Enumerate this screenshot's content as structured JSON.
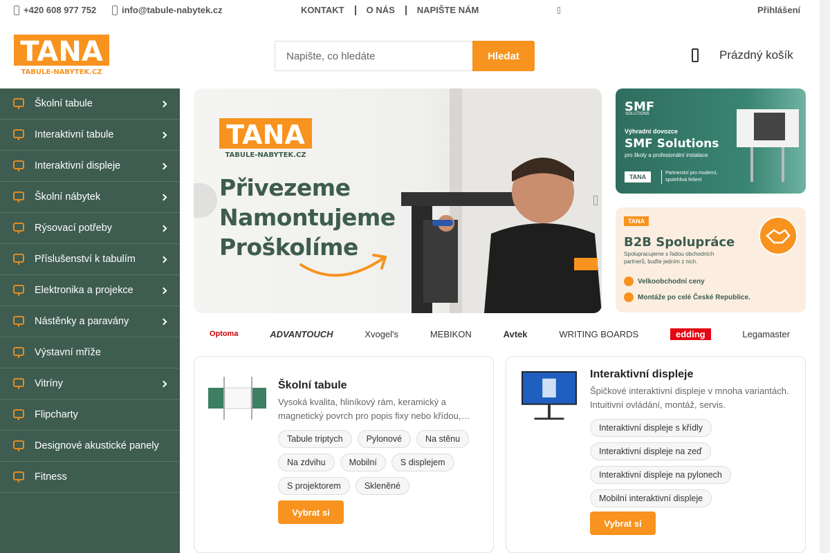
{
  "topbar": {
    "phone": "+420 608 977 752",
    "email": "info@tabule-nabytek.cz",
    "nav": [
      "KONTAKT",
      "O NÁS",
      "NAPIŠTE NÁM"
    ],
    "login": "Přihlášení"
  },
  "header": {
    "logo_text": "TANA",
    "logo_sub": "TABULE-NABYTEK.CZ",
    "search_placeholder": "Napište, co hledáte",
    "search_button": "Hledat",
    "cart_label": "Prázdný košík"
  },
  "sidebar": {
    "items": [
      {
        "label": "Školní tabule",
        "icon": "board-icon",
        "arrow": true
      },
      {
        "label": "Interaktivní tabule",
        "icon": "interactive-board-icon",
        "arrow": true
      },
      {
        "label": "Interaktivní displeje",
        "icon": "display-icon",
        "arrow": true
      },
      {
        "label": "Školní nábytek",
        "icon": "chair-icon",
        "arrow": true
      },
      {
        "label": "Rýsovací potřeby",
        "icon": "ruler-icon",
        "arrow": true
      },
      {
        "label": "Příslušenství k tabulím",
        "icon": "pencil-icon",
        "arrow": true
      },
      {
        "label": "Elektronika a projekce",
        "icon": "projector-icon",
        "arrow": true
      },
      {
        "label": "Nástěnky a paravány",
        "icon": "pin-icon",
        "arrow": true
      },
      {
        "label": "Výstavní mříže",
        "icon": "grid-icon",
        "arrow": false
      },
      {
        "label": "Vitríny",
        "icon": "cabinet-icon",
        "arrow": true
      },
      {
        "label": "Flipcharty",
        "icon": "flipchart-icon",
        "arrow": false
      },
      {
        "label": "Designové akustické panely",
        "icon": "sound-icon",
        "arrow": false
      },
      {
        "label": "Fitness",
        "icon": "dumbbell-icon",
        "arrow": false
      }
    ]
  },
  "banner": {
    "logo_text": "TANA",
    "logo_sub": "TABULE-NABYTEK.CZ",
    "lines": [
      "Přivezeme",
      "Namontujeme",
      "Proškolíme"
    ]
  },
  "promo1": {
    "brand": "SMF",
    "brand_sub": "SOLUTIONS",
    "kicker": "Výhradní dovozce",
    "title": "SMF Solutions",
    "subtitle": "pro školy a profesionální instalace",
    "logo_text": "TANA",
    "partner": "Partnerství pro moderní, spolehlivá řešení"
  },
  "promo2": {
    "logo_text": "TANA",
    "title": "B2B Spolupráce",
    "text": "Spolupracujeme s řadou obchodních partnerů, buďte jedním z nich.",
    "bullets": [
      "Velkoobchodní ceny",
      "Montáže po celé České Republice."
    ]
  },
  "brands": [
    "Optoma",
    "ADVANTOUCH",
    "Xvogel's",
    "MEBIKON",
    "Avtek",
    "WRITING BOARDS",
    "edding",
    "Legamaster"
  ],
  "cards": [
    {
      "title": "Školní tabule",
      "desc": "Vysoká kvalita, hliníkový rám, keramický a magnetický povrch pro popis fixy nebo křídou,…",
      "tags": [
        "Tabule triptych",
        "Pylonové",
        "Na stěnu",
        "Na zdvihu",
        "Mobilní",
        "S displejem",
        "S projektorem",
        "Skleněné"
      ],
      "button": "Vybrat si"
    },
    {
      "title": "Interaktivní displeje",
      "desc": "Špičkové interaktivní displeje v mnoha variantách. Intuitivní ovládání, montáž, servis.",
      "tags": [
        "Interaktivní displeje s křídly",
        "Interaktivní displeje na zeď",
        "Interaktivní displeje na pylonech",
        "Mobilní interaktivní displeje"
      ],
      "button": "Vybrat si"
    }
  ],
  "colors": {
    "accent": "#f7931e",
    "sidebar": "#3e5c50",
    "brand_green": "#3e5c50"
  }
}
